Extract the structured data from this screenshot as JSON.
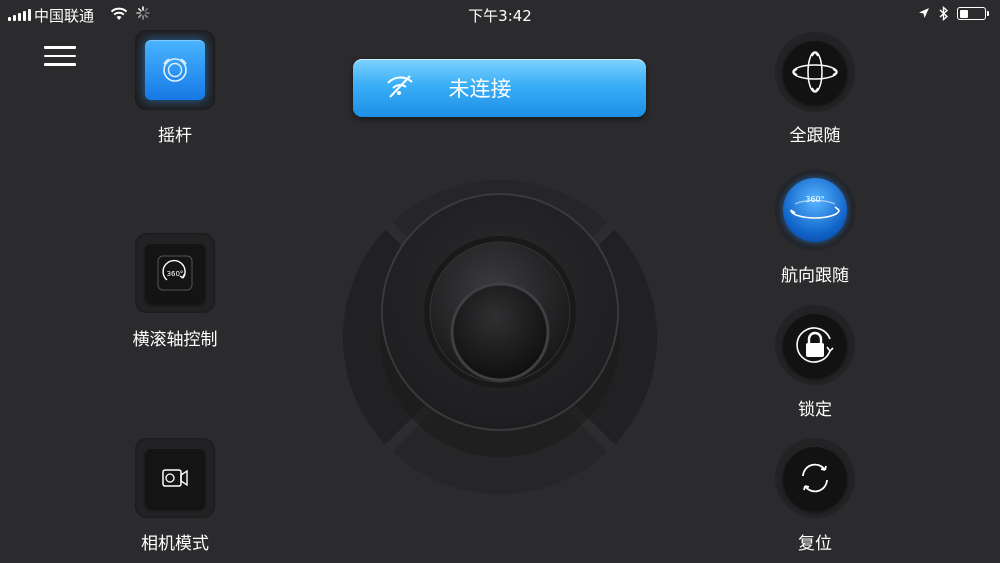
{
  "status_bar": {
    "carrier": "中国联通",
    "time": "下午3:42",
    "battery_level": 0.35
  },
  "left_modes": [
    {
      "label": "摇杆",
      "icon": "joystick-mode-icon",
      "active": true
    },
    {
      "label": "横滚轴控制",
      "icon": "roll-360-icon",
      "active": false
    },
    {
      "label": "相机模式",
      "icon": "camera-mode-icon",
      "active": false
    }
  ],
  "connection": {
    "status_text": "未连接",
    "icon": "wifi-off-icon"
  },
  "right_modes": [
    {
      "label": "全跟随",
      "icon": "full-follow-icon",
      "active": false
    },
    {
      "label": "航向跟随",
      "icon": "pan-follow-icon",
      "active": true,
      "badge": "360°"
    },
    {
      "label": "锁定",
      "icon": "lock-icon",
      "active": false
    },
    {
      "label": "复位",
      "icon": "reset-icon",
      "active": false
    }
  ],
  "colors": {
    "background": "#2b2b2d",
    "accent": "#2196f3"
  }
}
